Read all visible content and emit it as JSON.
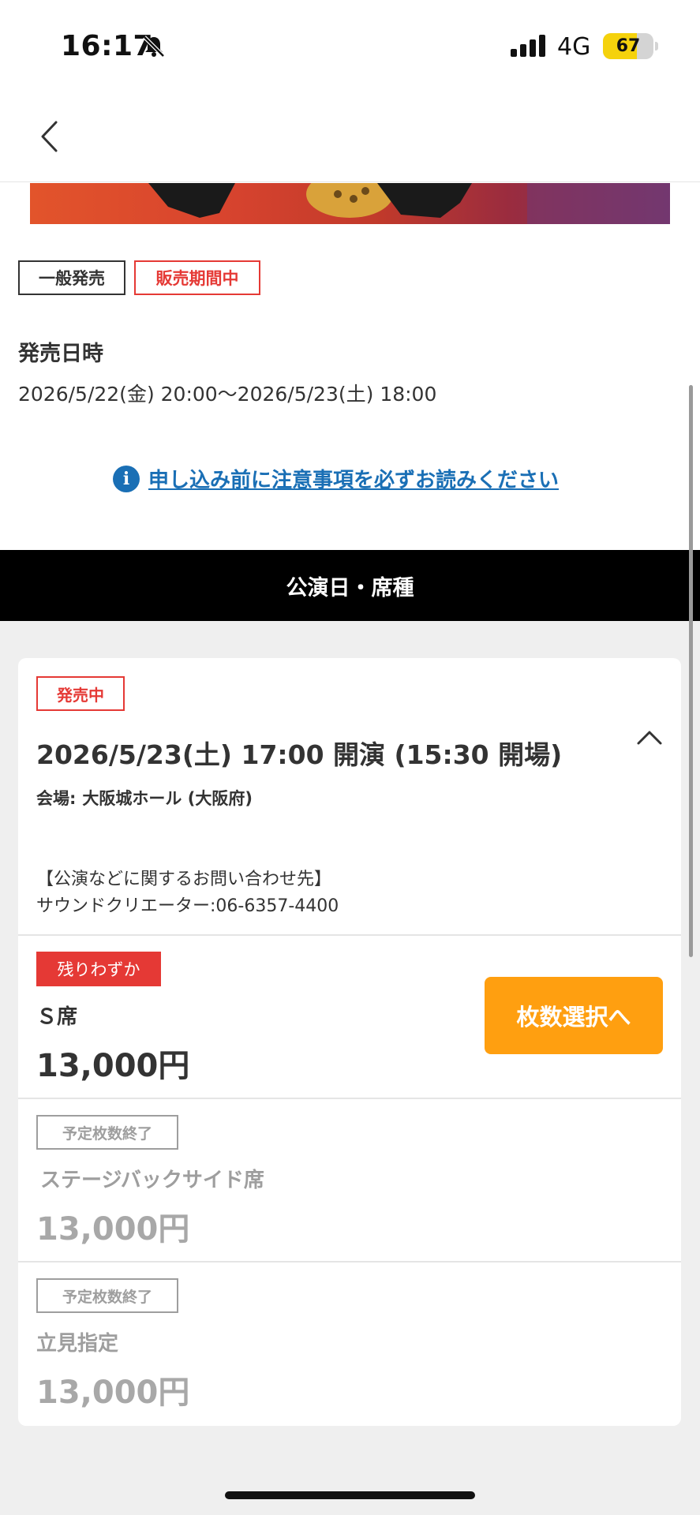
{
  "status_bar": {
    "time": "16:17",
    "network": "4G",
    "battery": "67",
    "battery_level": 0.67
  },
  "sale": {
    "badge_general": "一般発売",
    "badge_status": "販売期間中",
    "heading": "発売日時",
    "period": "2026/5/22(金) 20:00〜2026/5/23(土) 18:00",
    "notice_link": "申し込み前に注意事項を必ずお読みください"
  },
  "section": {
    "title": "公演日・席種"
  },
  "performance": {
    "status": "発売中",
    "datetime": "2026/5/23(土) 17:00 開演 (15:30 開場)",
    "venue_label": "会場:",
    "venue": "大阪城ホール (大阪府)",
    "contact_title": "【公演などに関するお問い合わせ先】",
    "contact_detail": "サウンドクリエーター:06-6357-4400"
  },
  "seats": [
    {
      "status": "残りわずか",
      "name": "Ｓ席",
      "price": "13,000円",
      "button": "枚数選択へ"
    },
    {
      "status": "予定枚数終了",
      "name": "ステージバックサイド席",
      "price": "13,000円"
    },
    {
      "status": "予定枚数終了",
      "name": "立見指定",
      "price": "13,000円"
    }
  ],
  "colors": {
    "accent_red": "#e53935",
    "link_blue": "#1a6fb5",
    "cta_orange": "#ff9f10",
    "battery_yellow": "#f5d20c"
  },
  "icons": [
    "bell-slash-icon",
    "signal-icon",
    "battery-icon",
    "back-chevron-icon",
    "info-icon",
    "chevron-up-icon"
  ]
}
